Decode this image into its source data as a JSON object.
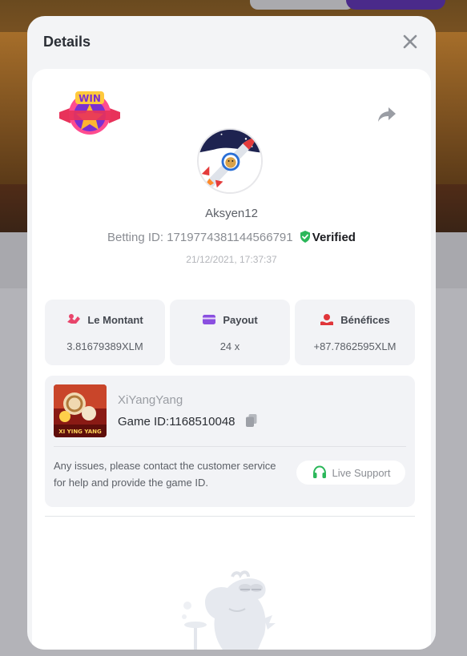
{
  "modal": {
    "title": "Details",
    "username": "Aksyen12",
    "betting_label": "Betting ID:",
    "betting_id": "1719774381144566791",
    "verified_label": "Verified",
    "timestamp": "21/12/2021, 17:37:37"
  },
  "stats": [
    {
      "label": "Le Montant",
      "value": "3.81679389XLM",
      "icon": "coins-icon",
      "color": "#e8456b"
    },
    {
      "label": "Payout",
      "value": "24 x",
      "icon": "card-icon",
      "color": "#8a4fe0"
    },
    {
      "label": "Bénéfices",
      "value": "+87.7862595XLM",
      "icon": "profit-icon",
      "color": "#e0353a"
    }
  ],
  "game": {
    "name": "XiYangYang",
    "id_label": "Game ID:",
    "id": "1168510048",
    "thumb_caption": "XI YING YANG",
    "support_text": "Any issues, please contact the customer service for help and provide the game ID.",
    "support_button": "Live Support"
  },
  "badge_text": "WIN",
  "colors": {
    "verified": "#2bb75a",
    "support": "#2bb75a",
    "modal_bg": "#f3f4f6"
  }
}
